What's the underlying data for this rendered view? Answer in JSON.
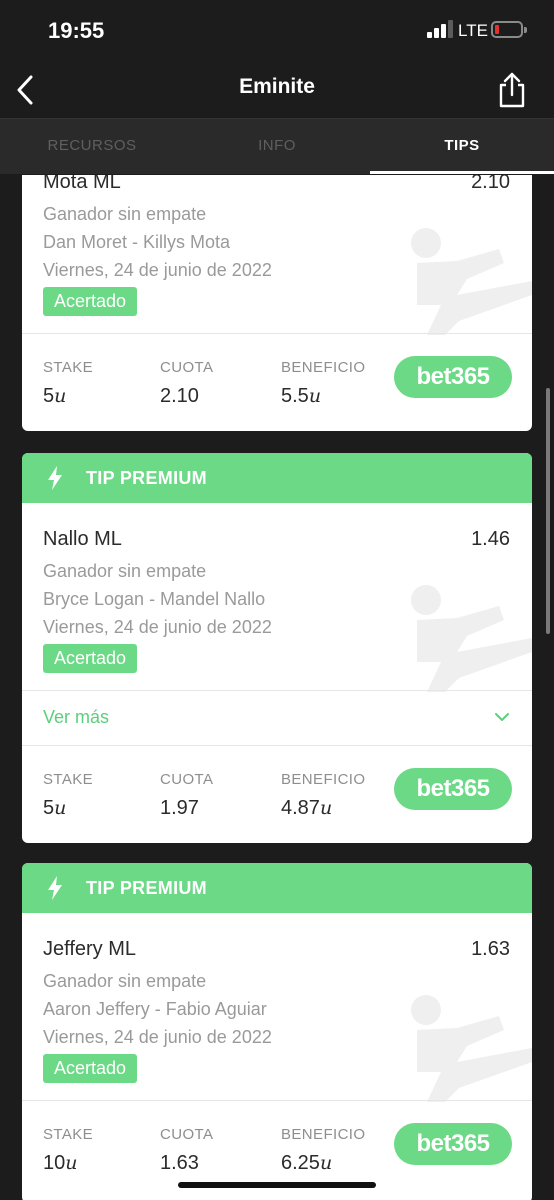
{
  "status_bar": {
    "time": "19:55",
    "network": "LTE"
  },
  "nav": {
    "title": "Eminite"
  },
  "tabs": [
    "RECURSOS",
    "INFO",
    "TIPS"
  ],
  "active_tab": "TIPS",
  "colors": {
    "accent": "#6cd987",
    "dark": "#1c1c1c",
    "tab_bar": "#2a2a2a"
  },
  "icons": {
    "back": "chevron-left-icon",
    "share": "share-icon",
    "premium": "bolt-icon",
    "expand": "chevron-down-icon",
    "sport": "kick-figure-icon"
  },
  "stat_labels": {
    "stake": "STAKE",
    "odds": "CUOTA",
    "profit": "BENEFICIO"
  },
  "unit": "u",
  "cards": [
    {
      "header": "",
      "pick": "Mota ML",
      "odds": "2.10",
      "market": "Ganador sin empate",
      "event": "Dan Moret - Killys Mota",
      "date": "Viernes, 24 de junio de 2022",
      "status": "Acertado",
      "more_label": "",
      "stake": "5",
      "cuota": "2.10",
      "beneficio": "5.5",
      "bookmaker": "bet365"
    },
    {
      "header": "TIP PREMIUM",
      "pick": "Nallo ML",
      "odds": "1.46",
      "market": "Ganador sin empate",
      "event": "Bryce Logan - Mandel Nallo",
      "date": "Viernes, 24 de junio de 2022",
      "status": "Acertado",
      "more_label": "Ver más",
      "stake": "5",
      "cuota": "1.97",
      "beneficio": "4.87",
      "bookmaker": "bet365"
    },
    {
      "header": "TIP PREMIUM",
      "pick": "Jeffery ML",
      "odds": "1.63",
      "market": "Ganador sin empate",
      "event": "Aaron Jeffery - Fabio Aguiar",
      "date": "Viernes, 24 de junio de 2022",
      "status": "Acertado",
      "more_label": "",
      "stake": "10",
      "cuota": "1.63",
      "beneficio": "6.25",
      "bookmaker": "bet365"
    }
  ]
}
